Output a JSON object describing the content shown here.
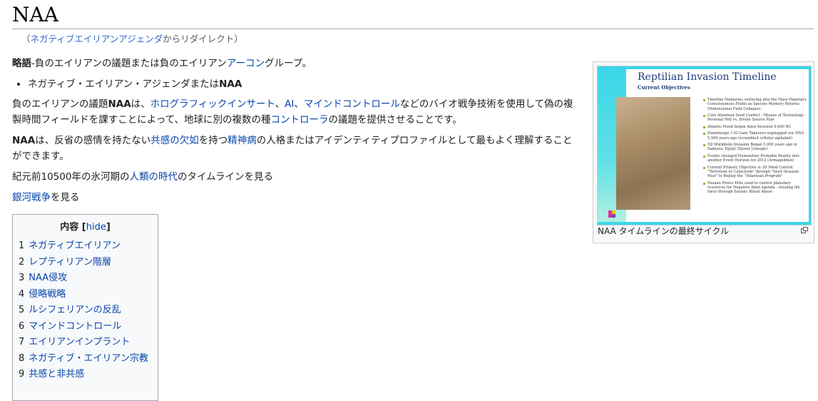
{
  "page": {
    "title": "NAA",
    "redirect": {
      "open": "（",
      "link": "ネガティブエイリアンアジェンダ",
      "suffix": "からリダイレクト）"
    }
  },
  "content": {
    "p1": {
      "a": "略語",
      "b": "-",
      "c": "負のエイリアンの議題または負のエイリアン",
      "link": "アーコン",
      "d": "グループ。"
    },
    "bullet": {
      "text": "ネガティブ・エイリアン・アジェンダまたは",
      "bold": "NAA"
    },
    "p2": {
      "a": "負のエイリアンの議題",
      "b": "NAA",
      "c": "は、",
      "link1": "ホログラフィックインサート",
      "sep1": "、",
      "link2": "AI",
      "sep2": "、",
      "link3": "マインドコントロール",
      "d": "などのバイオ戦争技術を使用して偽の複製時間フィールドを課すことによって、地球に別の複数の種",
      "link4": "コントローラ",
      "e": "の議題を提供させることです。"
    },
    "p3": {
      "bold": "NAA",
      "a": "は、反省の感情を持たない",
      "link1": "共感の欠如",
      "b": "を持つ",
      "link2": "精神病",
      "c": "の人格またはアイデンティティプロファイルとして最もよく理解することができます。"
    },
    "p4": {
      "a": "紀元前10500年の氷河期の",
      "link": "人類の時代",
      "b": "のタイムラインを見る"
    },
    "p5": {
      "link": "銀河戦争",
      "b": "を見る"
    }
  },
  "toc": {
    "title": "内容",
    "hide_open": "[",
    "hide": "hide",
    "hide_close": "]",
    "items": [
      {
        "num": "1",
        "label": "ネガティブエイリアン"
      },
      {
        "num": "2",
        "label": "レプティリアン階層"
      },
      {
        "num": "3",
        "label": "NAA侵攻"
      },
      {
        "num": "4",
        "label": "侵略戦略"
      },
      {
        "num": "5",
        "label": "ルシフェリアンの反乱"
      },
      {
        "num": "6",
        "label": "マインドコントロール"
      },
      {
        "num": "7",
        "label": "エイリアンインプラント"
      },
      {
        "num": "8",
        "label": "ネガティブ・エイリアン宗教"
      },
      {
        "num": "9",
        "label": "共感と非共感"
      }
    ]
  },
  "thumb": {
    "slide_title": "Reptilian Invasion Timeline",
    "slide_subtitle": "Current Objectives",
    "bullets": [
      "Timeline Memories surfacing into the Mass Planetary Consciousness Fields as Species Memory Returns (Dimensional Field Collapse)",
      "Core Atlantian Seed Conflict - Misuse of Technology - Personal Will vs. Divine Source Plan",
      "Atlantis Flood began Alien Invasion 9,600 BC",
      "Stonehenge 11D Gate Takeover unplugged our DNA 5,500 years ago (scrambled cellular alphabet)",
      "5D Wormhole Invasion Began 5,000 years ago in Sakkara, Egypt (Djoser Lineage)",
      "Events changed Humanities Probable Reality into another Event Horizon for 2012 (Armageddon)",
      "Current Primary Objective is 3D Mind Control \"Terrorism or Cataclysm\" through \"Seed Invasion Fear\" to Replay the \"Atlantean Program\"",
      "Human Power Elite used to control planetary resources for Negative Alien agenda - stealing life force through Satanic Ritual Abuse"
    ],
    "caption": "NAA タイムラインの最終サイクル"
  },
  "colors": {
    "link": "#0645ad",
    "rule": "#a2a9b1",
    "slide_accent": "#3ad6e8",
    "slide_title": "#1f3b7a",
    "bullet": "#7cc242"
  }
}
